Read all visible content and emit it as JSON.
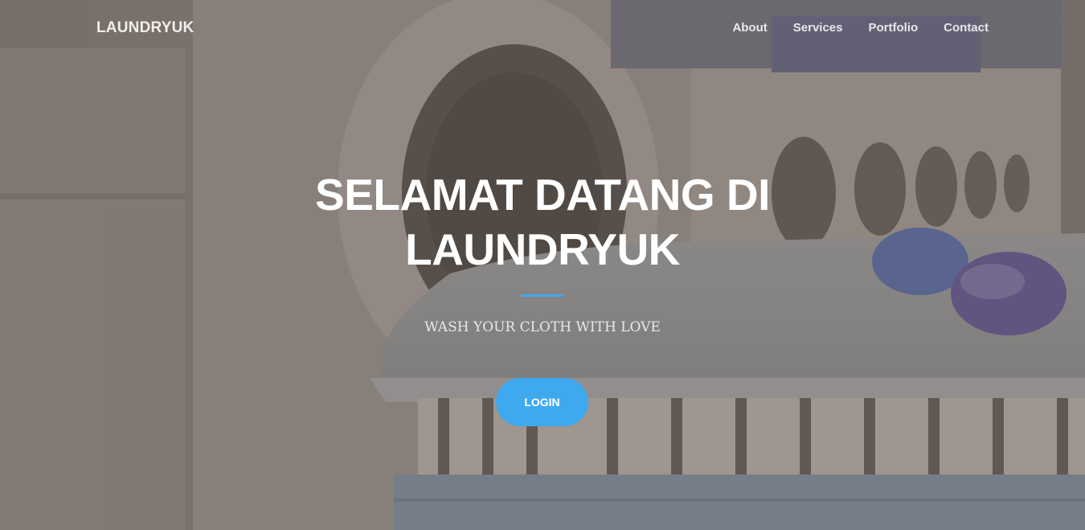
{
  "navbar": {
    "brand": "LAUNDRYUK",
    "links": [
      {
        "label": "About"
      },
      {
        "label": "Services"
      },
      {
        "label": "Portfolio"
      },
      {
        "label": "Contact"
      }
    ]
  },
  "hero": {
    "headline_line1": "SELAMAT DATANG DI",
    "headline_line2": "LAUNDRYUK",
    "subheading": "WASH YOUR CLOTH WITH LOVE",
    "login_label": "LOGIN",
    "background_image": "laundry-room-washing-machines-folded-clothes",
    "accent_color": "#3fa9ef"
  }
}
